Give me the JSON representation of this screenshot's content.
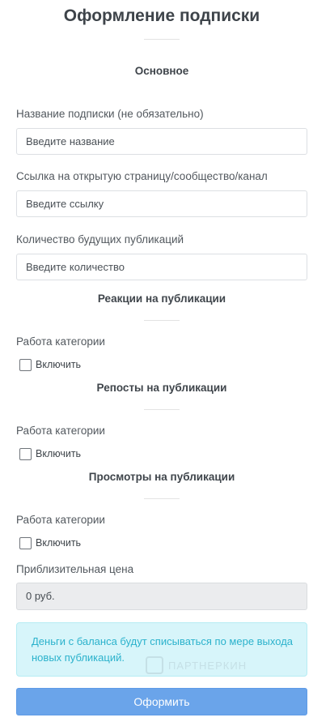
{
  "page": {
    "title": "Оформление подписки"
  },
  "sections": {
    "main": {
      "heading": "Основное"
    },
    "reactions": {
      "heading": "Реакции на публикации",
      "field_label": "Работа категории",
      "toggle_label": "Включить",
      "enabled": false
    },
    "reposts": {
      "heading": "Репосты на публикации",
      "field_label": "Работа категории",
      "toggle_label": "Включить",
      "enabled": false
    },
    "views": {
      "heading": "Просмотры на публикации",
      "field_label": "Работа категории",
      "toggle_label": "Включить",
      "enabled": false
    }
  },
  "form": {
    "name": {
      "label": "Название подписки (не обязательно)",
      "placeholder": "Введите название",
      "value": ""
    },
    "link": {
      "label": "Ссылка на открытую страницу/сообщество/канал",
      "placeholder": "Введите ссылку",
      "value": ""
    },
    "count": {
      "label": "Количество будущих публикаций",
      "placeholder": "Введите количество",
      "value": ""
    }
  },
  "price": {
    "label": "Приблизительная цена",
    "value": "0 руб."
  },
  "alert": {
    "text": "Деньги с баланса будут списываться по мере выхода новых публикаций."
  },
  "watermark": {
    "text": "ПАРТНЕРКИН"
  },
  "submit": {
    "label": "Оформить"
  },
  "colors": {
    "primary_button": "#6aa4ea",
    "alert_bg": "#d7f5fa",
    "alert_text": "#2bb2cc"
  }
}
